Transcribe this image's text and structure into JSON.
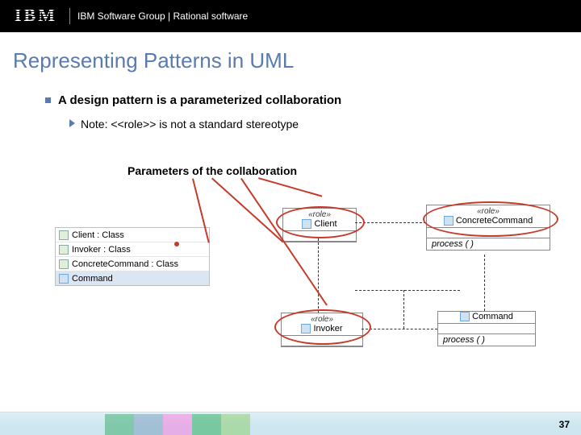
{
  "header": {
    "brand": "IBM",
    "group": "IBM Software Group | Rational software"
  },
  "title": "Representing Patterns in UML",
  "bullets": {
    "main": "A design pattern is a parameterized collaboration",
    "note": "Note: <<role>> is not a standard stereotype"
  },
  "param_label": "Parameters of the collaboration",
  "params": [
    {
      "name": "Client : Class"
    },
    {
      "name": "Invoker : Class"
    },
    {
      "name": "ConcreteCommand : Class"
    },
    {
      "name": "Command"
    }
  ],
  "classes": {
    "client": {
      "stereo": "«role»",
      "name": "Client"
    },
    "concrete": {
      "stereo": "«role»",
      "name": "ConcreteCommand",
      "op": "process ( )"
    },
    "invoker": {
      "stereo": "«role»",
      "name": "Invoker"
    },
    "command": {
      "name": "Command",
      "op": "process ( )"
    }
  },
  "page": "37"
}
